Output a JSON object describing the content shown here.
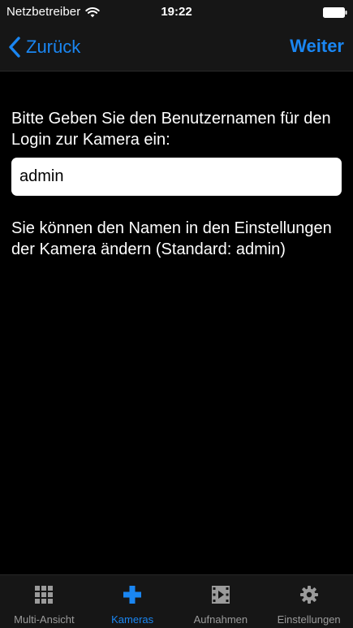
{
  "status_bar": {
    "carrier": "Netzbetreiber",
    "time": "19:22",
    "wifi_icon": "wifi-icon",
    "battery_icon": "battery-full-icon"
  },
  "nav": {
    "back_label": "Zurück",
    "next_label": "Weiter",
    "back_icon": "chevron-left-icon"
  },
  "content": {
    "prompt": "Bitte Geben Sie den Benutzernamen für den Login zur Kamera ein:",
    "username_value": "admin",
    "hint": "Sie können den Namen in den Einstellungen der Kamera ändern (Standard: admin)"
  },
  "tab_bar": {
    "active_index": 1,
    "tabs": [
      {
        "label": "Multi-Ansicht",
        "icon": "grid-icon"
      },
      {
        "label": "Kameras",
        "icon": "plus-icon"
      },
      {
        "label": "Aufnahmen",
        "icon": "film-icon"
      },
      {
        "label": "Einstellungen",
        "icon": "gear-icon"
      }
    ]
  },
  "colors": {
    "accent": "#1a86f2",
    "bar_background": "#161616",
    "background": "#000000",
    "inactive_tab": "#9b9b9b"
  }
}
